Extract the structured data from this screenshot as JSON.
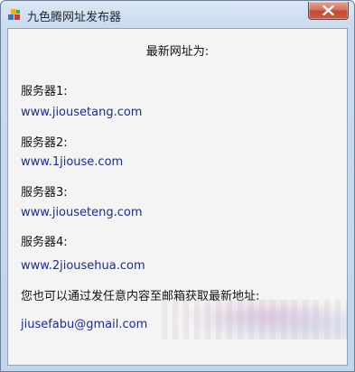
{
  "window": {
    "title": "九色腾网址发布器"
  },
  "content": {
    "heading": "最新网址为:",
    "servers": [
      {
        "label": "服务器1:",
        "url": "www.jiousetang.com"
      },
      {
        "label": "服务器2:",
        "url": "www.1jiouse.com"
      },
      {
        "label": "服务器3:",
        "url": "www.jiouseteng.com"
      },
      {
        "label": "服务器4:",
        "url": "www.2jiousehua.com"
      }
    ],
    "email_prompt": "您也可以通过发任意内容至邮箱获取最新地址:",
    "email": "jiusefabu@gmail.com"
  },
  "colors": {
    "link": "#1c2c94",
    "close_button": "#c14a32"
  },
  "icons": {
    "app": "app-icon",
    "close": "close-icon"
  }
}
